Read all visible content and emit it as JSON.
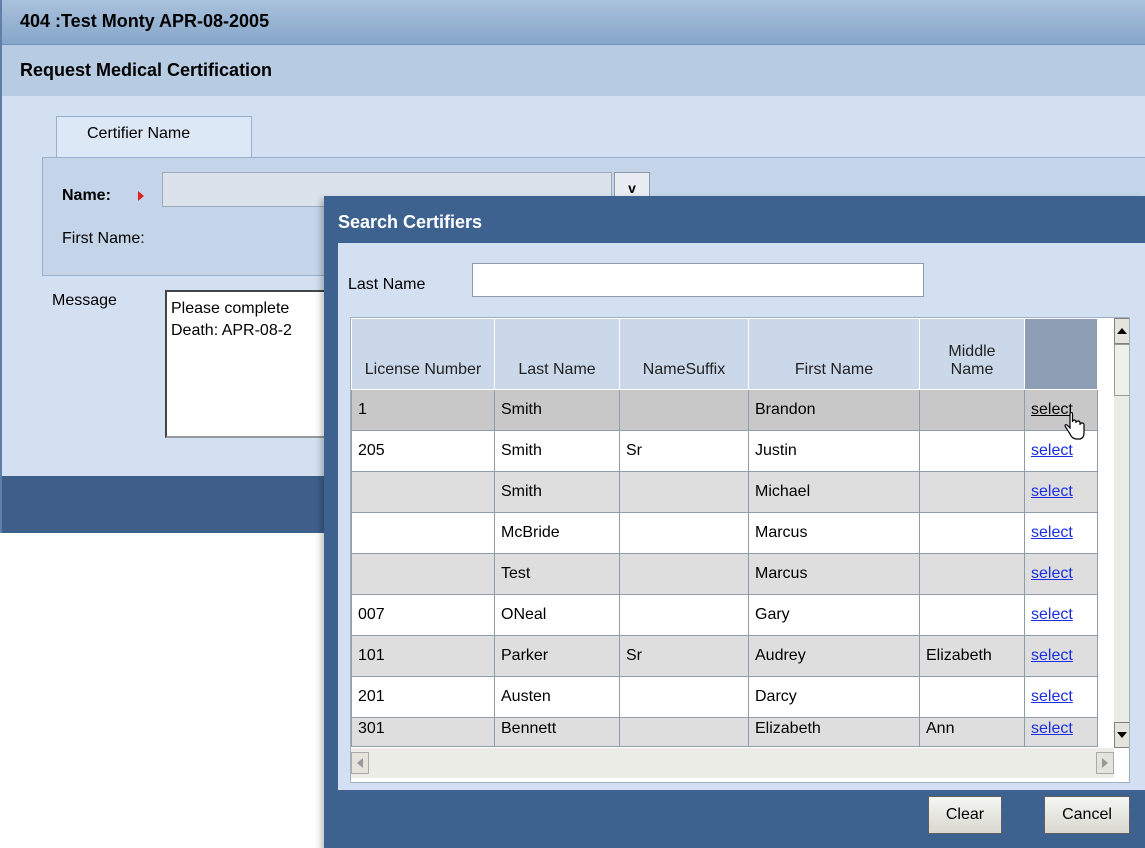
{
  "window": {
    "title": "404   :Test Monty  APR-08-2005",
    "header": "Request Medical Certification"
  },
  "form": {
    "tab_label": "Certifier Name",
    "name_label": "Name:",
    "name_value": "",
    "dropdown_label": "v",
    "first_name_label": "First Name:",
    "message_label": "Message",
    "message_text": "Please complete\nDeath: APR-08-2"
  },
  "modal": {
    "title": "Search Certifiers",
    "last_name_label": "Last Name",
    "last_name_value": "",
    "columns": [
      "License Number",
      "Last Name",
      "NameSuffix",
      "First Name",
      "Middle Name",
      ""
    ],
    "rows": [
      {
        "license": "1",
        "last": "Smith",
        "suffix": "",
        "first": "Brandon",
        "middle": "",
        "action": "select"
      },
      {
        "license": "205",
        "last": "Smith",
        "suffix": "Sr",
        "first": "Justin",
        "middle": "",
        "action": "select"
      },
      {
        "license": "",
        "last": "Smith",
        "suffix": "",
        "first": "Michael",
        "middle": "",
        "action": "select"
      },
      {
        "license": "",
        "last": "McBride",
        "suffix": "",
        "first": "Marcus",
        "middle": "",
        "action": "select"
      },
      {
        "license": "",
        "last": "Test",
        "suffix": "",
        "first": "Marcus",
        "middle": "",
        "action": "select"
      },
      {
        "license": "007",
        "last": "ONeal",
        "suffix": "",
        "first": "Gary",
        "middle": "",
        "action": "select"
      },
      {
        "license": "101",
        "last": "Parker",
        "suffix": "Sr",
        "first": "Audrey",
        "middle": "Elizabeth",
        "action": "select"
      },
      {
        "license": "201",
        "last": "Austen",
        "suffix": "",
        "first": "Darcy",
        "middle": "",
        "action": "select"
      },
      {
        "license": "301",
        "last": "Bennett",
        "suffix": "",
        "first": "Elizabeth",
        "middle": "Ann",
        "action": "select"
      }
    ],
    "buttons": {
      "clear": "Clear",
      "cancel": "Cancel"
    }
  },
  "colors": {
    "titlebar": "#86a6ca",
    "modal_frame": "#3e6290",
    "link": "#1a2ee0",
    "required_marker": "#dd2222"
  }
}
